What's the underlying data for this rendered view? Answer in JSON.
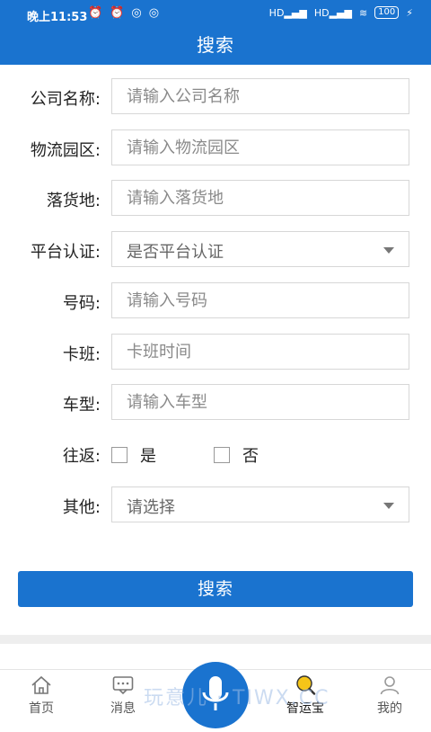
{
  "status": {
    "time": "晚上11:53",
    "signal1": "HD",
    "signal2": "HD",
    "battery": "100"
  },
  "header": {
    "title": "搜索"
  },
  "form": {
    "company": {
      "label": "公司名称:",
      "placeholder": "请输入公司名称"
    },
    "park": {
      "label": "物流园区:",
      "placeholder": "请输入物流园区"
    },
    "destination": {
      "label": "落货地:",
      "placeholder": "请输入落货地"
    },
    "platform": {
      "label": "平台认证:",
      "value": "是否平台认证"
    },
    "number": {
      "label": "号码:",
      "placeholder": "请输入号码"
    },
    "shift": {
      "label": "卡班:",
      "placeholder": "卡班时间"
    },
    "vehicle": {
      "label": "车型:",
      "placeholder": "请输入车型"
    },
    "roundtrip": {
      "label": "往返:",
      "yes": "是",
      "no": "否"
    },
    "other": {
      "label": "其他:",
      "value": "请选择"
    }
  },
  "search_button": "搜索",
  "tabs": [
    {
      "label": "首页",
      "icon": "home-icon"
    },
    {
      "label": "消息",
      "icon": "message-icon"
    },
    {
      "label": "智运宝",
      "icon": "search-magnifier-icon"
    },
    {
      "label": "我的",
      "icon": "user-icon"
    }
  ],
  "watermark": "玩意儿 · TIWX.CC",
  "colors": {
    "primary": "#1a73cf",
    "accent": "#f5c518"
  }
}
